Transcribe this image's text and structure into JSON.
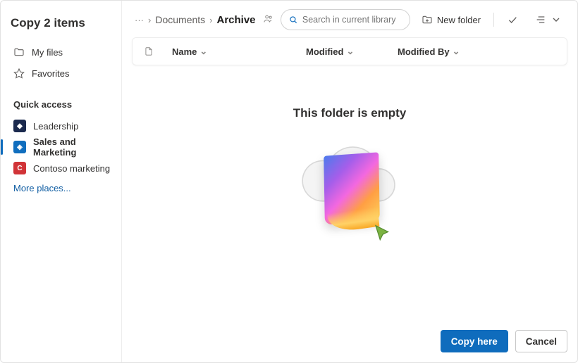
{
  "title": "Copy 2 items",
  "sidebar": {
    "nav": [
      {
        "label": "My files",
        "icon": "folder-icon"
      },
      {
        "label": "Favorites",
        "icon": "star-icon"
      }
    ],
    "quick_access_label": "Quick access",
    "quick_access": [
      {
        "label": "Leadership",
        "badge_bg": "#1b2a4e",
        "selected": false
      },
      {
        "label": "Sales and Marketing",
        "badge_bg": "#106ebe",
        "selected": true
      },
      {
        "label": "Contoso marketing",
        "badge_bg": "#d13438",
        "selected": false
      }
    ],
    "more_places": "More places..."
  },
  "breadcrumb": {
    "ellipsis": "···",
    "items": [
      {
        "label": "Documents",
        "current": false
      },
      {
        "label": "Archive",
        "current": true
      }
    ]
  },
  "search": {
    "placeholder": "Search in current library"
  },
  "toolbar": {
    "new_folder": "New folder"
  },
  "columns": {
    "name": "Name",
    "modified": "Modified",
    "modified_by": "Modified By"
  },
  "empty": {
    "title": "This folder is empty"
  },
  "footer": {
    "primary": "Copy here",
    "secondary": "Cancel"
  }
}
